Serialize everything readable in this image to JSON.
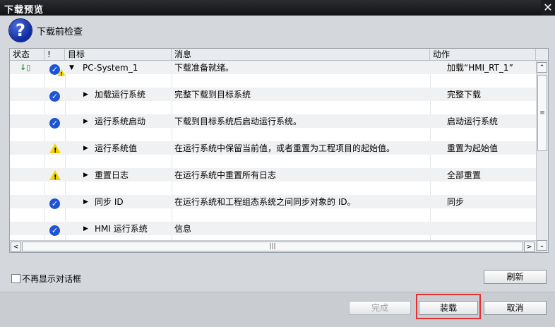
{
  "window": {
    "title": "下载预览",
    "close": "✕"
  },
  "header": {
    "title": "下载前检查",
    "icon": "question-icon"
  },
  "table": {
    "columns": [
      "状态",
      "!",
      "目标",
      "消息",
      "动作"
    ],
    "status_icon": "download-icon",
    "rows": [
      {
        "target": "PC-System_1",
        "message": "下载准备就绪。",
        "action": "加载“HMI_RT_1”",
        "icon": "check-warning-icon",
        "caret": "▼"
      },
      {
        "target": "加载运行系统",
        "message": "完整下载到目标系统",
        "action": "完整下载",
        "icon": "check-icon",
        "caret": "▶"
      },
      {
        "target": "运行系统启动",
        "message": "下载到目标系统后启动运行系统。",
        "action": "启动运行系统",
        "icon": "check-icon",
        "caret": "▶"
      },
      {
        "target": "运行系统值",
        "message": "在运行系统中保留当前值，或者重置为工程项目的起始值。",
        "action": "重置为起始值",
        "icon": "warning-icon",
        "caret": "▶"
      },
      {
        "target": "重置日志",
        "message": "在运行系统中重置所有日志",
        "action": "全部重置",
        "icon": "warning-icon",
        "caret": "▶"
      },
      {
        "target": "同步 ID",
        "message": "在运行系统和工程组态系统之间同步对象的 ID。",
        "action": "同步",
        "icon": "check-icon",
        "caret": "▶"
      },
      {
        "target": "HMI 运行系统",
        "message": "信息",
        "action": "",
        "icon": "check-icon",
        "caret": "▶"
      }
    ]
  },
  "scroll": {
    "up": "⌃",
    "down": "⌄",
    "left": "<",
    "right": ">",
    "grip_v": "≡",
    "grip_h": "|||"
  },
  "footer": {
    "dont_show": "不再显示对话框",
    "refresh": "刷新",
    "finish": "完成",
    "load": "装载",
    "cancel": "取消"
  }
}
